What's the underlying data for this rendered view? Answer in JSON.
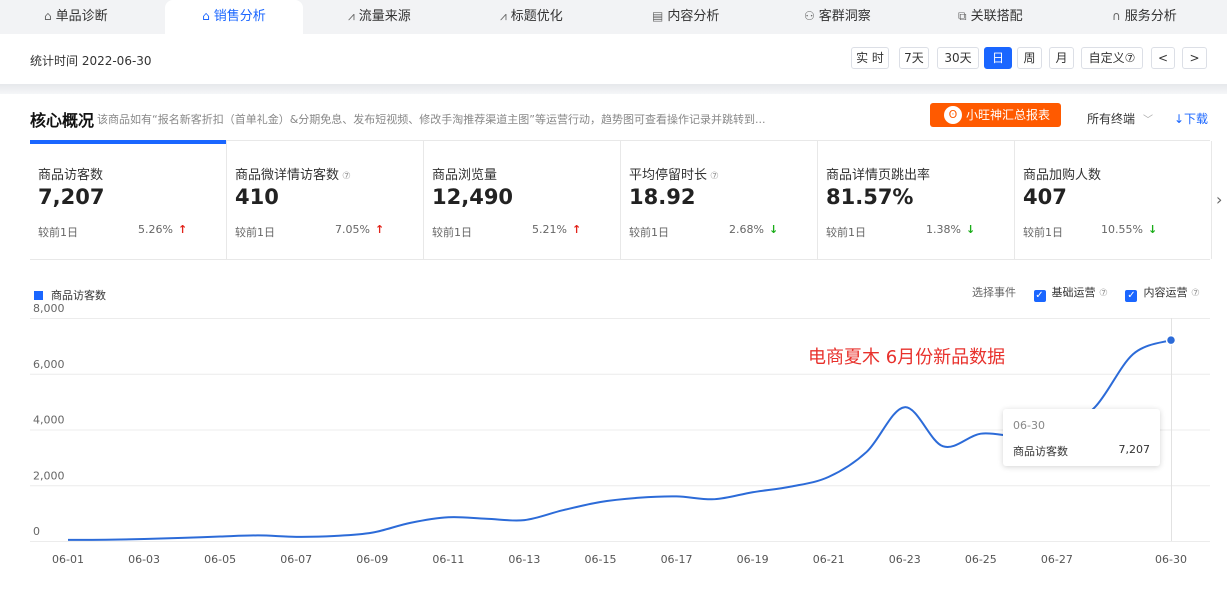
{
  "nav": {
    "tabs": [
      {
        "label": "单品诊断",
        "icon": "bag-icon",
        "glyph": "⌂",
        "active": false
      },
      {
        "label": "销售分析",
        "icon": "bag-icon",
        "glyph": "⌂",
        "active": true
      },
      {
        "label": "流量来源",
        "icon": "line-chart-icon",
        "glyph": "⩘",
        "active": false
      },
      {
        "label": "标题优化",
        "icon": "line-chart-icon",
        "glyph": "⩘",
        "active": false
      },
      {
        "label": "内容分析",
        "icon": "document-icon",
        "glyph": "▤",
        "active": false
      },
      {
        "label": "客群洞察",
        "icon": "people-icon",
        "glyph": "⚇",
        "active": false
      },
      {
        "label": "关联搭配",
        "icon": "link-icon",
        "glyph": "⧉",
        "active": false
      },
      {
        "label": "服务分析",
        "icon": "headset-icon",
        "glyph": "∩",
        "active": false
      }
    ]
  },
  "toolbar": {
    "stat_time": "统计时间 2022-06-30",
    "buttons": [
      {
        "label": "实 时",
        "active": false
      },
      {
        "label": "7天",
        "active": false
      },
      {
        "label": "30天",
        "active": false
      },
      {
        "label": "日",
        "active": true
      },
      {
        "label": "周",
        "active": false
      },
      {
        "label": "月",
        "active": false
      },
      {
        "label": "自定义⑦",
        "active": false
      },
      {
        "label": "<",
        "active": false
      },
      {
        "label": ">",
        "active": false
      }
    ]
  },
  "core": {
    "title": "核心概况",
    "description": "该商品如有“报名新客折扣（首单礼金）&分期免息、发布短视频、修改手淘推荐渠道主图”等运营行动，趋势图可查看操作记录并跳转到...",
    "report_button": "小旺神汇总报表",
    "terminal": "所有终端",
    "download": "↓下载"
  },
  "metrics": [
    {
      "label": "商品访客数",
      "help": false,
      "value": "7,207",
      "compare": "较前1日",
      "pct": "5.26%",
      "dir": "up"
    },
    {
      "label": "商品微详情访客数",
      "help": true,
      "value": "410",
      "compare": "较前1日",
      "pct": "7.05%",
      "dir": "up"
    },
    {
      "label": "商品浏览量",
      "help": false,
      "value": "12,490",
      "compare": "较前1日",
      "pct": "5.21%",
      "dir": "up"
    },
    {
      "label": "平均停留时长",
      "help": true,
      "value": "18.92",
      "compare": "较前1日",
      "pct": "2.68%",
      "dir": "down"
    },
    {
      "label": "商品详情页跳出率",
      "help": false,
      "value": "81.57%",
      "compare": "较前1日",
      "pct": "1.38%",
      "dir": "down"
    },
    {
      "label": "商品加购人数",
      "help": false,
      "value": "407",
      "compare": "较前1日",
      "pct": "10.55%",
      "dir": "down"
    }
  ],
  "chart_controls": {
    "legend": "商品访客数",
    "select_event": "选择事件",
    "event1": "基础运营",
    "event2": "内容运营",
    "help_glyph": "⑦"
  },
  "tooltip": {
    "date": "06-30",
    "name": "商品访客数",
    "value": "7,207"
  },
  "annotation": "电商夏木 6月份新品数据",
  "colors": {
    "accent": "#1a66ff",
    "line": "#2c6bd8",
    "up": "#e2231a",
    "down": "#1aad19",
    "report": "#ff5a00",
    "annotation": "#e8312c"
  },
  "chart_data": {
    "type": "line",
    "x": [
      "06-01",
      "06-02",
      "06-03",
      "06-04",
      "06-05",
      "06-06",
      "06-07",
      "06-08",
      "06-09",
      "06-10",
      "06-11",
      "06-12",
      "06-13",
      "06-14",
      "06-15",
      "06-16",
      "06-17",
      "06-18",
      "06-19",
      "06-20",
      "06-21",
      "06-22",
      "06-23",
      "06-24",
      "06-25",
      "06-26",
      "06-27",
      "06-28",
      "06-29",
      "06-30"
    ],
    "series": [
      {
        "name": "商品访客数",
        "values": [
          40,
          45,
          70,
          110,
          160,
          200,
          150,
          180,
          300,
          650,
          850,
          800,
          750,
          1100,
          1400,
          1550,
          1600,
          1500,
          1750,
          1950,
          2300,
          3200,
          4800,
          3400,
          3850,
          3750,
          3900,
          4800,
          6700,
          7207
        ]
      }
    ],
    "x_ticks": [
      "06-01",
      "06-03",
      "06-05",
      "06-07",
      "06-09",
      "06-11",
      "06-13",
      "06-15",
      "06-17",
      "06-19",
      "06-21",
      "06-23",
      "06-25",
      "06-27",
      "06-30"
    ],
    "y_ticks": [
      "0",
      "2,000",
      "4,000",
      "6,000",
      "8,000"
    ],
    "ylim": [
      0,
      8000
    ],
    "grid": true,
    "legend_position": "top-left"
  }
}
